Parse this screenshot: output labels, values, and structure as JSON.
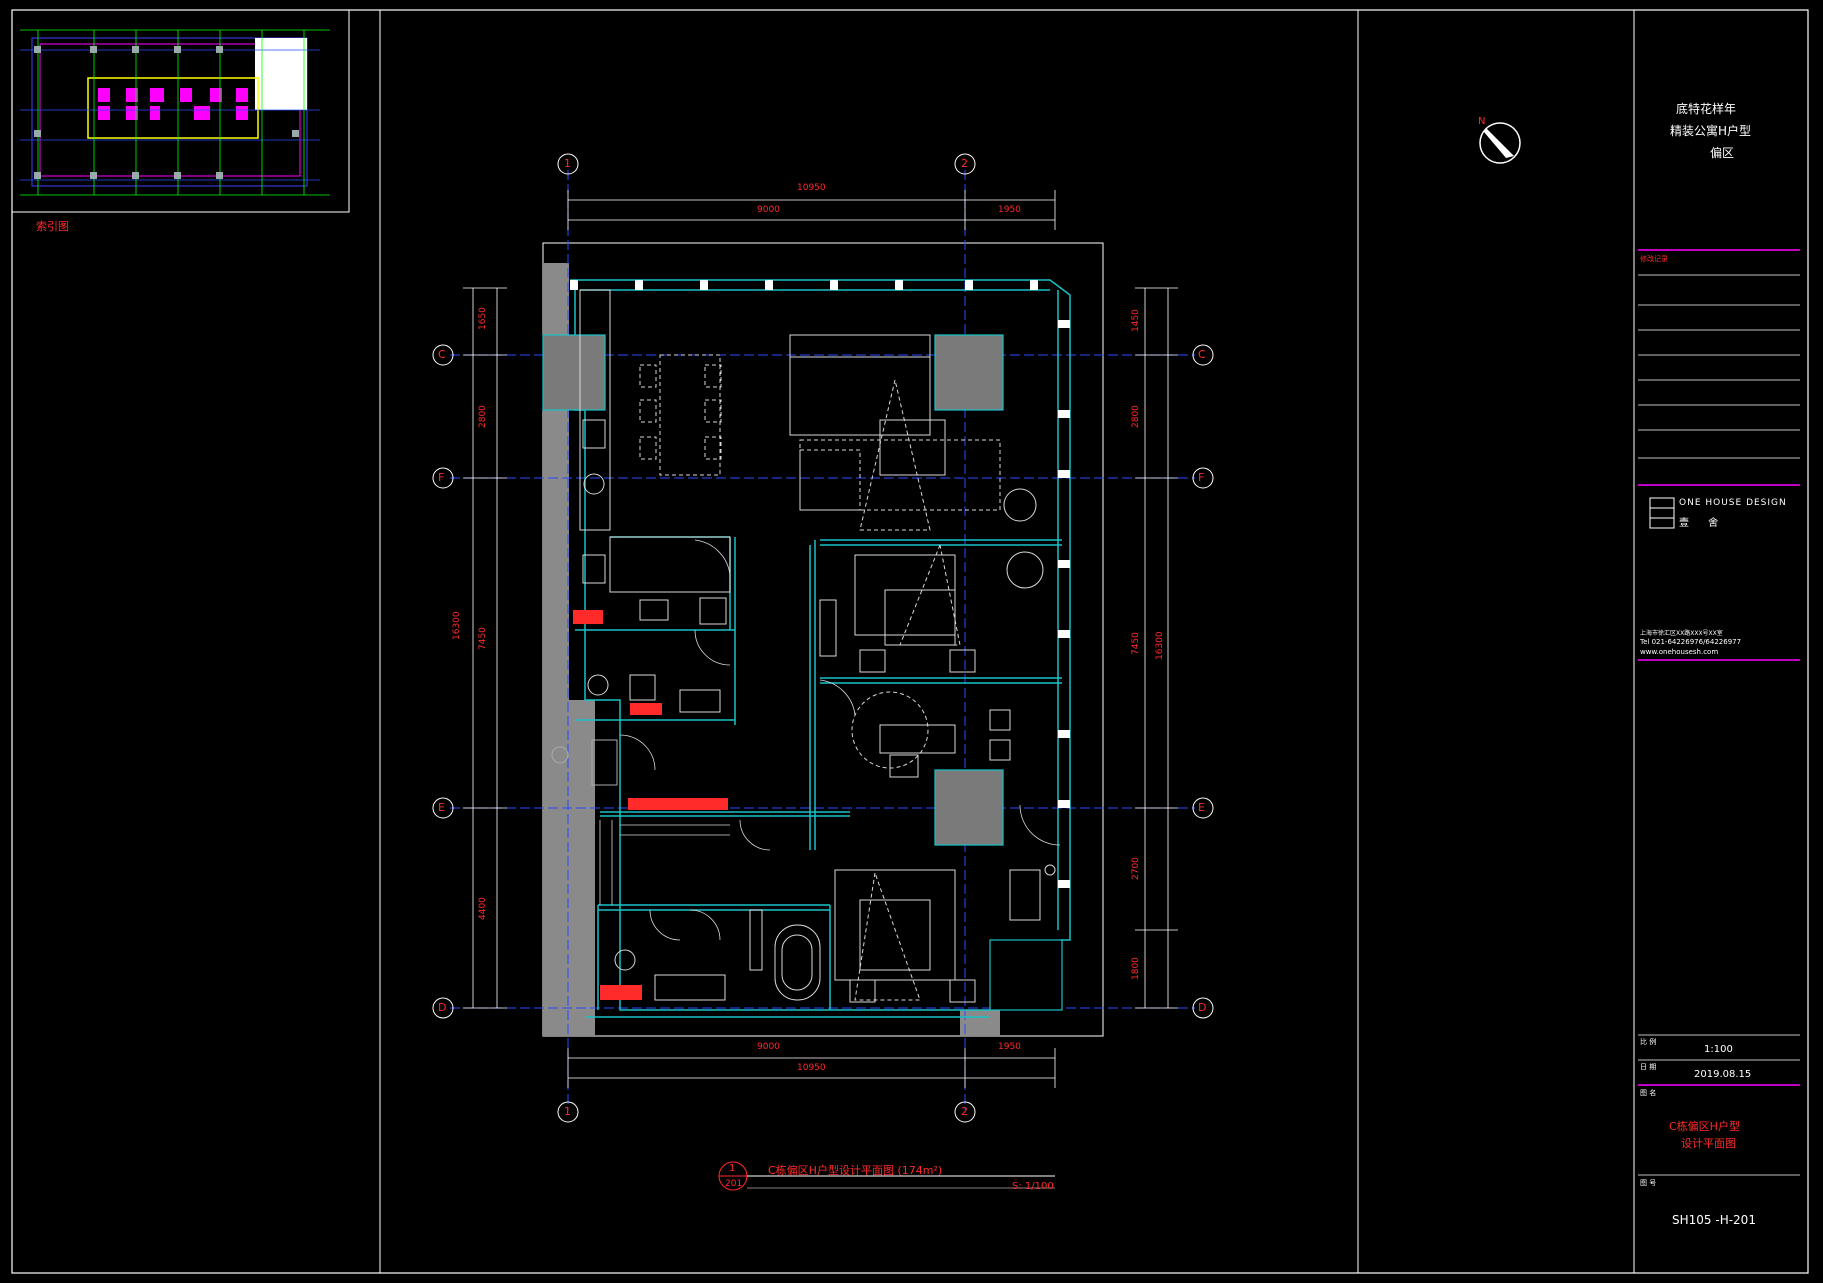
{
  "key_plan": {
    "label": "索引图"
  },
  "grid": {
    "col_1": "1",
    "col_2": "2",
    "row_top": "C",
    "row_f": "F",
    "row_e": "E",
    "row_bottom": "D"
  },
  "dimensions": {
    "top_overall": "10950",
    "top_a": "9000",
    "top_b": "1950",
    "bottom_overall": "10950",
    "bottom_a": "9000",
    "bottom_b": "1950",
    "left_overall": "16300",
    "left_1": "1650",
    "left_2": "2800",
    "left_3": "7450",
    "left_4": "4400",
    "right_overall": "16300",
    "right_1": "1450",
    "right_2": "2800",
    "right_3": "7450",
    "right_4": "2700",
    "right_5": "1800"
  },
  "drawing_title": {
    "number": "1",
    "sheet_ref": "201",
    "title": "C栋偏区H户型设计平面图 (174m²)",
    "scale": "S: 1/100"
  },
  "title_block": {
    "project_line_1": "底特花样年",
    "project_line_2": "精装公寓H户型",
    "project_line_3": "偏区",
    "revision_label": "修改记录",
    "company_name": "ONE HOUSE DESIGN",
    "company_cn": "壹 舍",
    "address": "上海市徐汇区XX路XXX号XX室",
    "tel": "Tel 021-64226976/64226977",
    "website": "www.onehousesh.com",
    "scale_label": "比 例",
    "scale_value": "1:100",
    "date_label": "日 期",
    "date_value": "2019.08.15",
    "drawing_name_label": "图 名",
    "drawing_name_1": "C栋偏区H户型",
    "drawing_name_2": "设计平面图",
    "drawing_no_label": "图 号",
    "drawing_no": "SH105 -H-201"
  },
  "colors": {
    "frame": "#ffffff",
    "grid_axis": "#2a4bff",
    "dimension": "#ff2a2a",
    "wall": "#19c2c8",
    "furniture": "#d8d8d8",
    "accent": "#ff00ff",
    "column": "#808080"
  }
}
